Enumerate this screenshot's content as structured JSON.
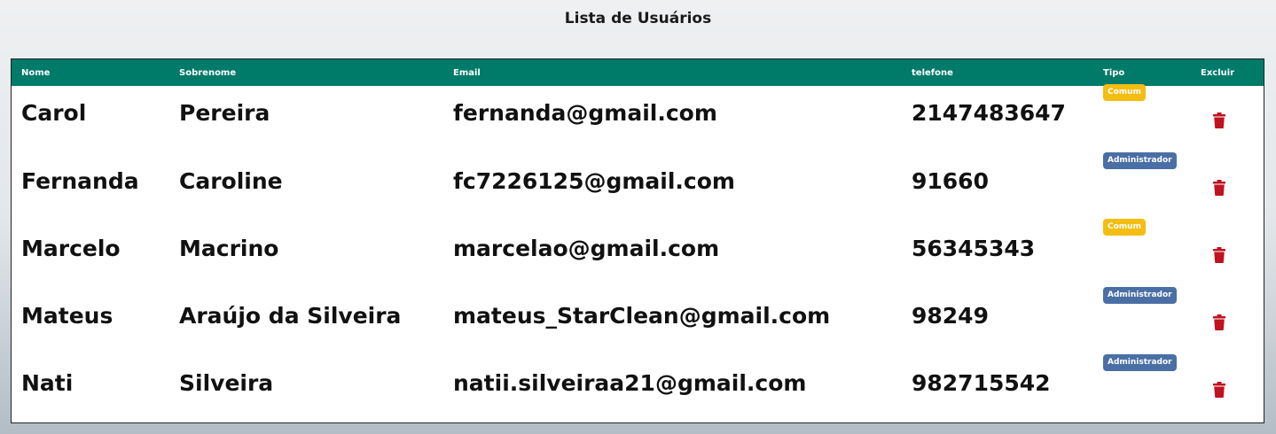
{
  "page_title": "Lista de Usuários",
  "table": {
    "headers": {
      "nome": "Nome",
      "sobrenome": "Sobrenome",
      "email": "Email",
      "telefone": "telefone",
      "tipo": "Tipo",
      "excluir": "Excluir"
    },
    "rows": [
      {
        "nome": "Carol",
        "sobrenome": "Pereira",
        "email": "fernanda@gmail.com",
        "telefone": "2147483647",
        "tipo": "Comum",
        "tipo_style": "comum"
      },
      {
        "nome": "Fernanda",
        "sobrenome": "Caroline",
        "email": "fc7226125@gmail.com",
        "telefone": "91660",
        "tipo": "Administrador",
        "tipo_style": "admin"
      },
      {
        "nome": "Marcelo",
        "sobrenome": "Macrino",
        "email": "marcelao@gmail.com",
        "telefone": "56345343",
        "tipo": "Comum",
        "tipo_style": "comum"
      },
      {
        "nome": "Mateus",
        "sobrenome": "Araújo da Silveira",
        "email": "mateus_StarClean@gmail.com",
        "telefone": "98249",
        "tipo": "Administrador",
        "tipo_style": "admin"
      },
      {
        "nome": "Nati",
        "sobrenome": "Silveira",
        "email": "natii.silveiraa21@gmail.com",
        "telefone": "982715542",
        "tipo": "Administrador",
        "tipo_style": "admin"
      }
    ]
  },
  "colors": {
    "header_bg": "#007a69",
    "badge_comum": "#f4bd12",
    "badge_admin": "#4a6fa5",
    "delete_icon": "#c0121f"
  },
  "icons": {
    "delete": "trash-icon"
  }
}
